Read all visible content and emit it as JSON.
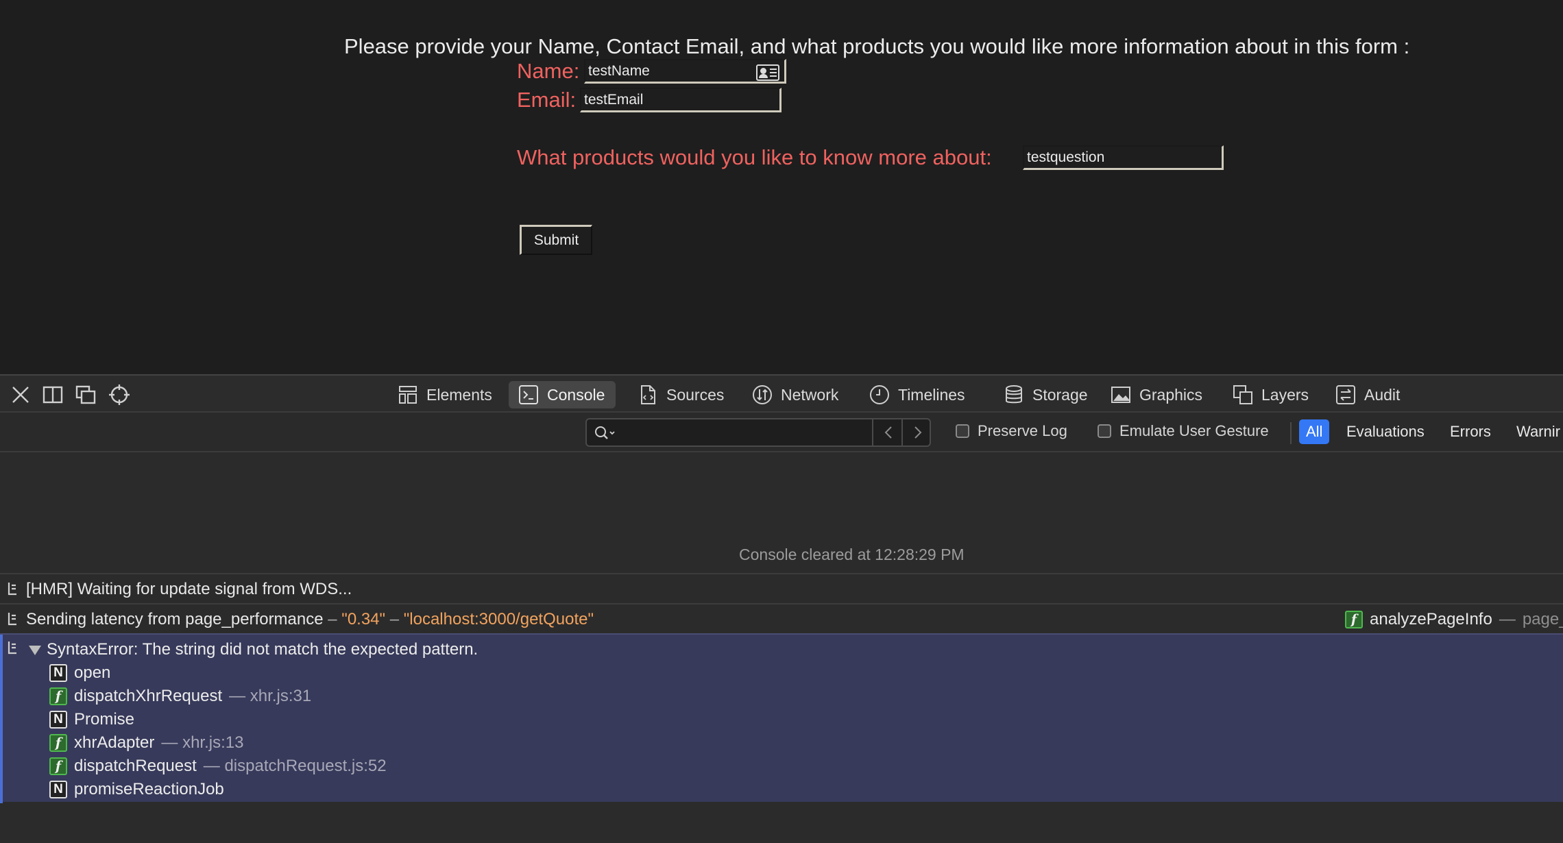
{
  "page": {
    "intro": "Please provide your Name, Contact Email, and what products you would like more information about in this form :",
    "name_label": "Name:",
    "name_value": "testName",
    "email_label": "Email:",
    "email_value": "testEmail",
    "products_label": "What products would you like to know more about:",
    "products_value": "testquestion",
    "submit_label": "Submit"
  },
  "devtools": {
    "tabs": [
      {
        "label": "Elements",
        "icon": "elements-icon"
      },
      {
        "label": "Console",
        "icon": "console-icon",
        "active": true
      },
      {
        "label": "Sources",
        "icon": "sources-icon"
      },
      {
        "label": "Network",
        "icon": "network-icon"
      },
      {
        "label": "Timelines",
        "icon": "timelines-icon"
      },
      {
        "label": "Storage",
        "icon": "storage-icon"
      },
      {
        "label": "Graphics",
        "icon": "graphics-icon"
      },
      {
        "label": "Layers",
        "icon": "layers-icon"
      },
      {
        "label": "Audit",
        "icon": "audit-icon"
      }
    ],
    "filter": {
      "search_value": "",
      "preserve_log": "Preserve Log",
      "emulate_gesture": "Emulate User Gesture",
      "levels": [
        "All",
        "Evaluations",
        "Errors",
        "Warnir"
      ]
    },
    "console": {
      "cleared": "Console cleared at 12:28:29 PM",
      "hmr": "[HMR] Waiting for update signal from WDS...",
      "latency_prefix": "Sending latency from page_performance",
      "dash": "–",
      "latency_value": "\"0.34\"",
      "latency_url": "\"localhost:3000/getQuote\"",
      "latency_src_func": "analyzePageInfo",
      "latency_src_dash": "—",
      "latency_src_file": "page_",
      "error_message": "SyntaxError: The string did not match the expected pattern.",
      "frames": [
        {
          "type": "N",
          "name": "open",
          "loc": ""
        },
        {
          "type": "f",
          "name": "dispatchXhrRequest",
          "loc": "— xhr.js:31"
        },
        {
          "type": "N",
          "name": "Promise",
          "loc": ""
        },
        {
          "type": "f",
          "name": "xhrAdapter",
          "loc": "— xhr.js:13"
        },
        {
          "type": "f",
          "name": "dispatchRequest",
          "loc": "— dispatchRequest.js:52"
        },
        {
          "type": "N",
          "name": "promiseReactionJob",
          "loc": ""
        }
      ]
    }
  }
}
